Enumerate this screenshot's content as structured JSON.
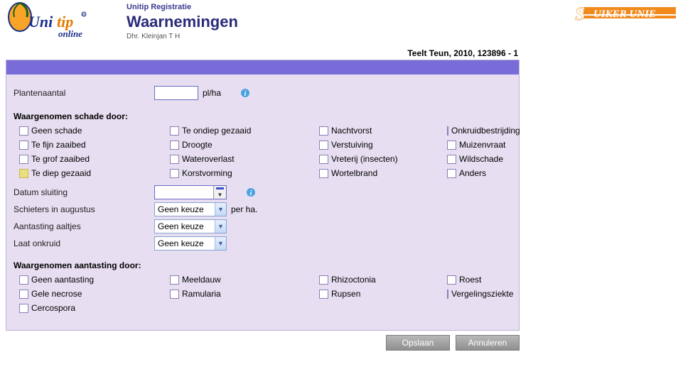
{
  "header": {
    "app_section": "Unitip Registratie",
    "page_title": "Waarnemingen",
    "user": "Dhr. Kleinjan T H",
    "logo_text_uni": "Uni",
    "logo_text_tip": "tip",
    "logo_online": "online",
    "right_logo_prefix": "S",
    "right_logo_text": "UIKER UNIE"
  },
  "context": "Teelt Teun, 2010, 123896 - 1",
  "form": {
    "plantenaantal_label": "Plantenaantal",
    "plantenaantal_value": "",
    "plantenaantal_unit": "pl/ha",
    "schade_heading": "Waargenomen schade door:",
    "schade": {
      "geen_schade": "Geen schade",
      "te_fijn_zaaibed": "Te fijn zaaibed",
      "te_grof_zaaibed": "Te grof zaaibed",
      "te_diep_gezaaid": "Te diep gezaaid",
      "te_ondiep_gezaaid": "Te ondiep gezaaid",
      "droogte": "Droogte",
      "wateroverlast": "Wateroverlast",
      "korstvorming": "Korstvorming",
      "nachtvorst": "Nachtvorst",
      "verstuiving": "Verstuiving",
      "vreterij": "Vreterij (insecten)",
      "wortelbrand": "Wortelbrand",
      "onkruidbestrijding": "Onkruidbestrijding",
      "muizenvraat": "Muizenvraat",
      "wildschade": "Wildschade",
      "anders": "Anders"
    },
    "datum_sluiting_label": "Datum sluiting",
    "datum_sluiting_value": "",
    "schieters_label": "Schieters in augustus",
    "schieters_value": "Geen keuze",
    "schieters_unit": "per ha.",
    "aaltjes_label": "Aantasting aaltjes",
    "aaltjes_value": "Geen keuze",
    "onkruid_label": "Laat onkruid",
    "onkruid_value": "Geen keuze",
    "aantasting_heading": "Waargenomen aantasting door:",
    "aantasting": {
      "geen_aantasting": "Geen aantasting",
      "gele_necrose": "Gele necrose",
      "cercospora": "Cercospora",
      "meeldauw": "Meeldauw",
      "ramularia": "Ramularia",
      "rhizoctonia": "Rhizoctonia",
      "rupsen": "Rupsen",
      "roest": "Roest",
      "vergelingsziekte": "Vergelingsziekte"
    }
  },
  "buttons": {
    "save": "Opslaan",
    "cancel": "Annuleren"
  }
}
